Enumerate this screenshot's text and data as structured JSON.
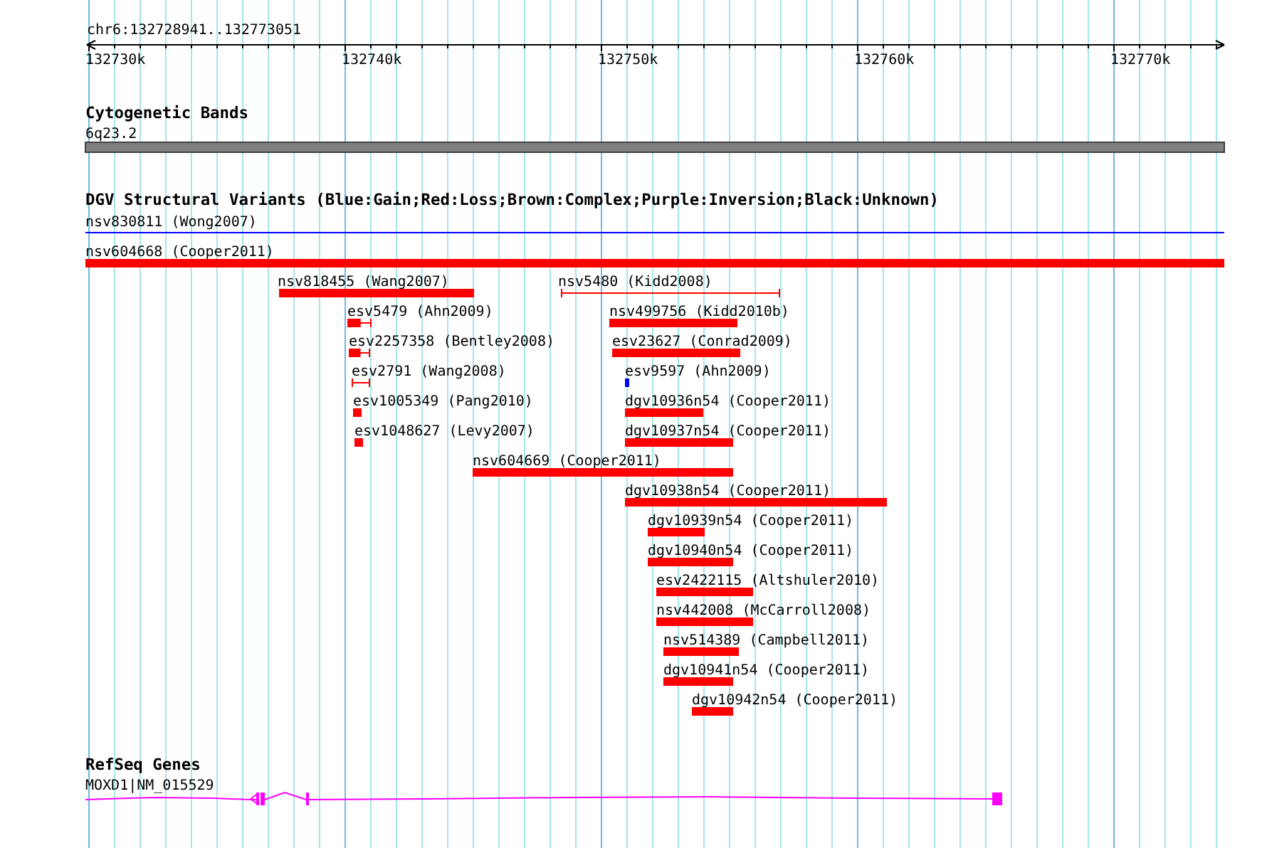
{
  "ruler": {
    "region": "chr6:132728941..132773051",
    "ticks": [
      "132730k",
      "132740k",
      "132750k",
      "132760k",
      "132770k"
    ]
  },
  "tracks": [
    {
      "kind": "bands",
      "title": "Cytogenetic Bands",
      "bands": [
        {
          "label": "6q23.2",
          "color": "#808080"
        }
      ]
    },
    {
      "kind": "variants",
      "title": "DGV Structural Variants (Blue:Gain;Red:Loss;Brown:Complex;Purple:Inversion;Black:Unknown)",
      "features": [
        {
          "label": "nsv830811 (Wong2007)",
          "kind": "line",
          "color": "#0000ff"
        },
        {
          "label": "nsv604668 (Cooper2011)",
          "kind": "bar",
          "color": "#ff0000"
        },
        {
          "label": "nsv818455 (Wang2007)",
          "kind": "bar",
          "color": "#ff0000"
        },
        {
          "label": "nsv5480 (Kidd2008)",
          "kind": "interval",
          "color": "#ff0000"
        },
        {
          "label": "esv5479 (Ahn2009)",
          "kind": "capped",
          "color": "#ff0000"
        },
        {
          "label": "nsv499756 (Kidd2010b)",
          "kind": "bar",
          "color": "#ff0000"
        },
        {
          "label": "esv2257358 (Bentley2008)",
          "kind": "capped",
          "color": "#ff0000"
        },
        {
          "label": "esv23627 (Conrad2009)",
          "kind": "bar",
          "color": "#ff0000"
        },
        {
          "label": "esv2791 (Wang2008)",
          "kind": "interval",
          "color": "#ff0000"
        },
        {
          "label": "esv9597 (Ahn2009)",
          "kind": "bar",
          "color": "#0000ff"
        },
        {
          "label": "esv1005349 (Pang2010)",
          "kind": "bar",
          "color": "#ff0000"
        },
        {
          "label": "dgv10936n54 (Cooper2011)",
          "kind": "bar",
          "color": "#ff0000"
        },
        {
          "label": "esv1048627 (Levy2007)",
          "kind": "bar",
          "color": "#ff0000"
        },
        {
          "label": "dgv10937n54 (Cooper2011)",
          "kind": "bar",
          "color": "#ff0000"
        },
        {
          "label": "nsv604669 (Cooper2011)",
          "kind": "bar",
          "color": "#ff0000"
        },
        {
          "label": "dgv10938n54 (Cooper2011)",
          "kind": "bar",
          "color": "#ff0000"
        },
        {
          "label": "dgv10939n54 (Cooper2011)",
          "kind": "bar",
          "color": "#ff0000"
        },
        {
          "label": "dgv10940n54 (Cooper2011)",
          "kind": "bar",
          "color": "#ff0000"
        },
        {
          "label": "esv2422115 (Altshuler2010)",
          "kind": "bar",
          "color": "#ff0000"
        },
        {
          "label": "nsv442008 (McCarroll2008)",
          "kind": "bar",
          "color": "#ff0000"
        },
        {
          "label": "nsv514389 (Campbell2011)",
          "kind": "bar",
          "color": "#ff0000"
        },
        {
          "label": "dgv10941n54 (Cooper2011)",
          "kind": "bar",
          "color": "#ff0000"
        },
        {
          "label": "dgv10942n54 (Cooper2011)",
          "kind": "bar",
          "color": "#ff0000"
        }
      ]
    },
    {
      "kind": "genes",
      "title": "RefSeq Genes",
      "genes": [
        {
          "label": "MOXD1|NM_015529",
          "color": "#ff00ff"
        }
      ]
    }
  ]
}
